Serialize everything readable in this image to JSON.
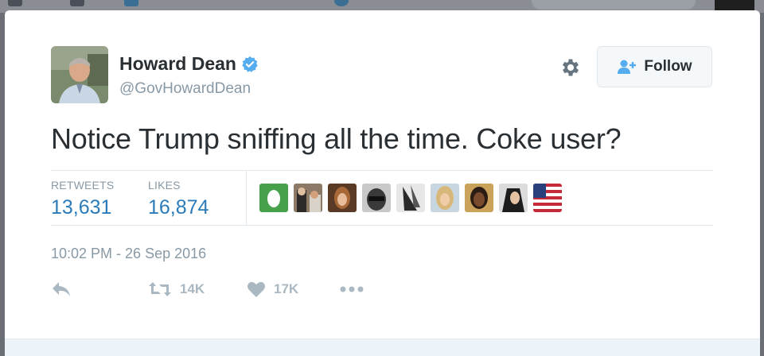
{
  "tweet": {
    "display_name": "Howard Dean",
    "handle": "@GovHowardDean",
    "verified": true,
    "text": "Notice Trump sniffing all the time. Coke user?",
    "timestamp": "10:02 PM - 26 Sep 2016"
  },
  "header": {
    "follow_label": "Follow"
  },
  "stats": {
    "retweets_label": "RETWEETS",
    "retweets_value": "13,631",
    "likes_label": "LIKES",
    "likes_value": "16,874"
  },
  "actions": {
    "retweet_count": "14K",
    "like_count": "17K"
  },
  "colors": {
    "text_primary": "#292f33",
    "text_secondary": "#8899a6",
    "link_blue": "#2b7bb9",
    "verified_blue": "#55acee",
    "action_gray": "#aab8c2"
  },
  "icons": [
    "verified-icon",
    "gear-icon",
    "follow-person-icon",
    "reply-icon",
    "retweet-icon",
    "heart-icon",
    "more-icon"
  ]
}
